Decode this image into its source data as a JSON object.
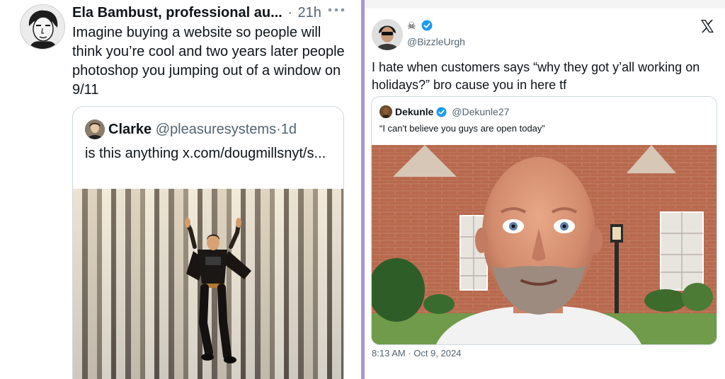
{
  "left_post": {
    "author_name": "Ela Bambust, professional au...",
    "separator": "·",
    "time": "21h",
    "more_icon": "more-dots-icon",
    "text": "Imagine buying a website so people will think you’re cool and two years later people photoshop you jumping out of a window on 9/11",
    "quote": {
      "author_name": "Clarke",
      "handle": "@pleasuresystems",
      "separator": "·",
      "time": "1d",
      "text": "is this anything x.com/dougmillsnyt/s..."
    }
  },
  "right_post": {
    "author_emoji": "☠",
    "handle": "@BizzleUrgh",
    "platform_icon": "x-logo-icon",
    "text": "I hate when customers says “why they got y’all working on holidays?” bro cause you in here tf",
    "quote": {
      "author_name": "Dekunle",
      "handle": "@Dekunle27",
      "text": "“I can't believe you guys are open today”"
    },
    "timestamp": "8:13 AM · Oct 9, 2024"
  },
  "colors": {
    "divider": "#a996d8",
    "verified_blue": "#1d9bf0",
    "secondary_text": "#536471"
  }
}
